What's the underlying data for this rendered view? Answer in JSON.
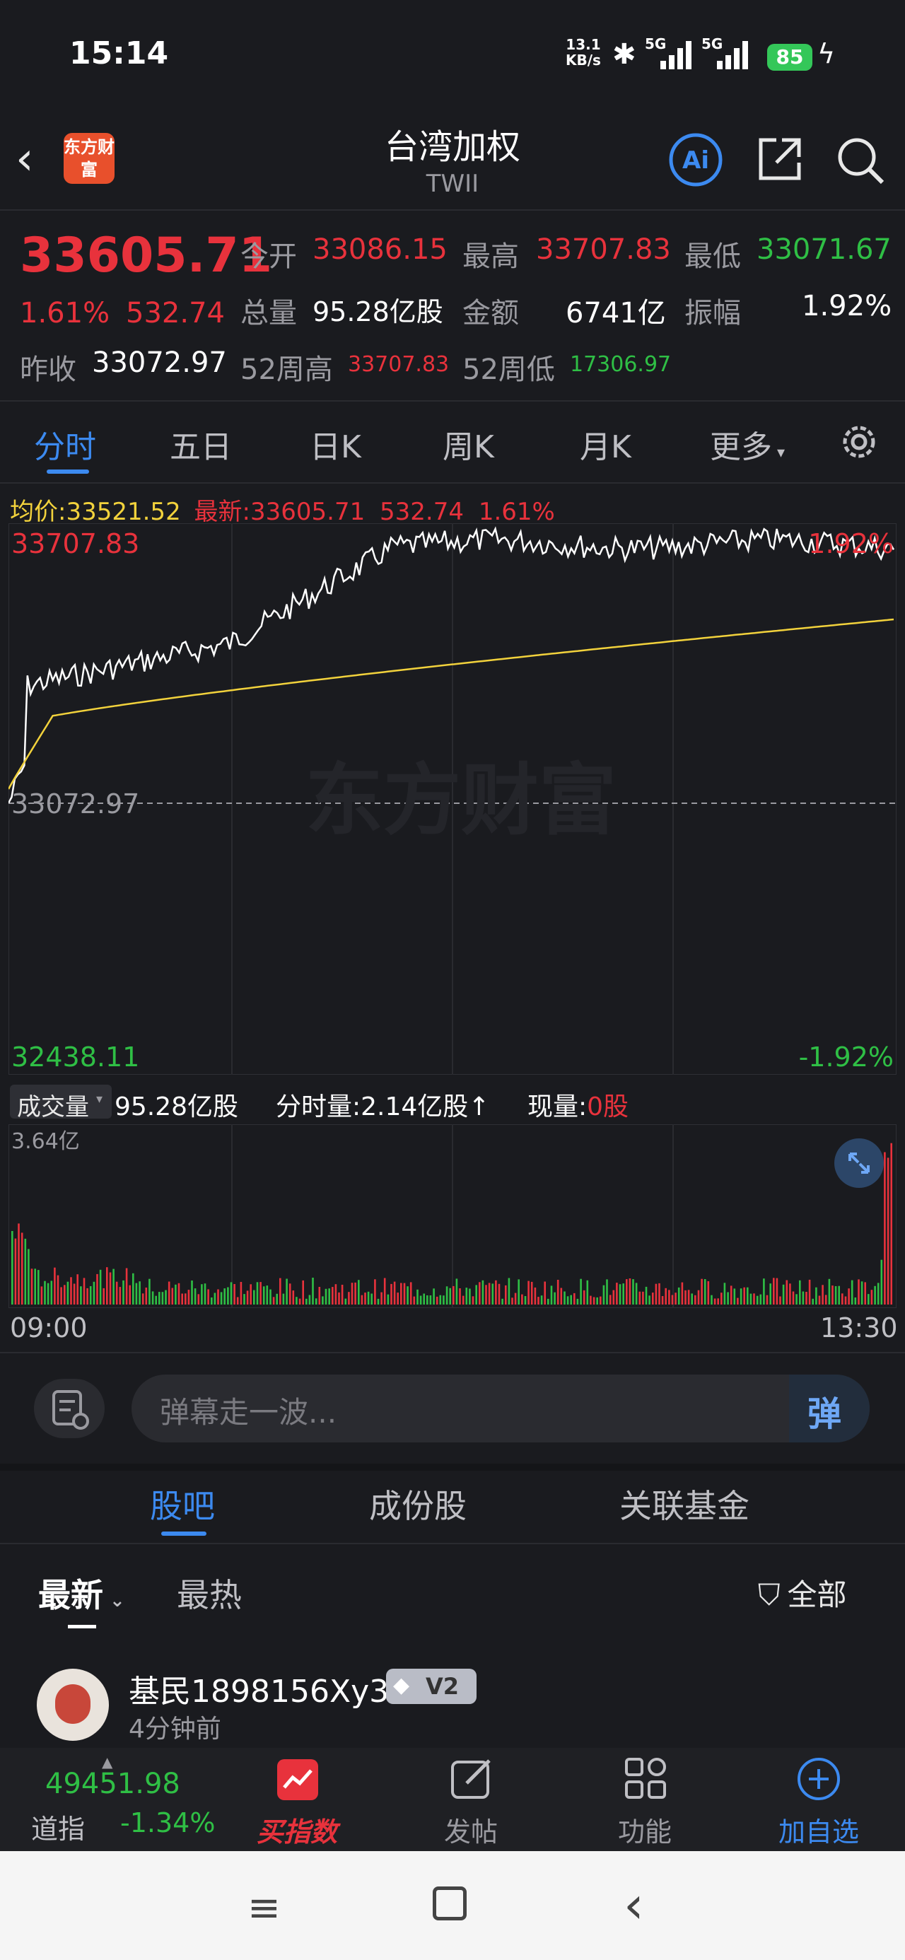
{
  "status": {
    "time": "15:14",
    "net_speed": "13.1",
    "net_unit": "KB/s",
    "signal1": "5G",
    "signal2": "5G",
    "battery": "85"
  },
  "header": {
    "logo_text": "东方财富",
    "title": "台湾加权",
    "subtitle": "TWII"
  },
  "quote": {
    "price": "33605.71",
    "change_pct": "1.61%",
    "change": "532.74",
    "open_label": "今开",
    "open": "33086.15",
    "high_label": "最高",
    "high": "33707.83",
    "low_label": "最低",
    "low": "33071.67",
    "vol_label": "总量",
    "vol": "95.28亿股",
    "amount_label": "金额",
    "amount": "6741亿",
    "amp_label": "振幅",
    "amp": "1.92%",
    "prev_label": "昨收",
    "prev": "33072.97",
    "w52h_label": "52周高",
    "w52h": "33707.83",
    "w52l_label": "52周低",
    "w52l": "17306.97"
  },
  "tabs": [
    "分时",
    "五日",
    "日K",
    "周K",
    "月K",
    "更多"
  ],
  "chart_info": {
    "avg_label": "均价:",
    "avg": "33521.52",
    "latest_label": "最新:",
    "latest": "33605.71",
    "latest_change": "532.74",
    "latest_pct": "1.61%",
    "top_price": "33707.83",
    "top_pct": "1.92%",
    "mid_price": "33072.97",
    "bottom_price": "32438.11",
    "bottom_pct": "-1.92%",
    "watermark": "东方财富"
  },
  "volume_bar": {
    "selector": "成交量",
    "total": "95.28亿股",
    "period_label": "分时量:",
    "period": "2.14亿股",
    "now_label": "现量:",
    "now": "0股",
    "max_label": "3.64亿",
    "start_time": "09:00",
    "end_time": "13:30"
  },
  "danmu": {
    "placeholder": "弹幕走一波...",
    "button": "弹"
  },
  "section_tabs": [
    "股吧",
    "成份股",
    "关联基金"
  ],
  "filter": {
    "latest": "最新",
    "hot": "最热",
    "all": "全部"
  },
  "post": {
    "user": "基民1898156Xy3",
    "level": "V2",
    "time": "4分钟前"
  },
  "bottom_nav": {
    "dow_value": "49451.98",
    "dow_label": "道指",
    "dow_pct": "-1.34%",
    "buy": "买指数",
    "post": "发帖",
    "func": "功能",
    "add": "加自选"
  },
  "colors": {
    "up": "#e8323c",
    "down": "#2fbf45",
    "avg_line": "#f2d23c",
    "accent": "#3c8af0"
  }
}
